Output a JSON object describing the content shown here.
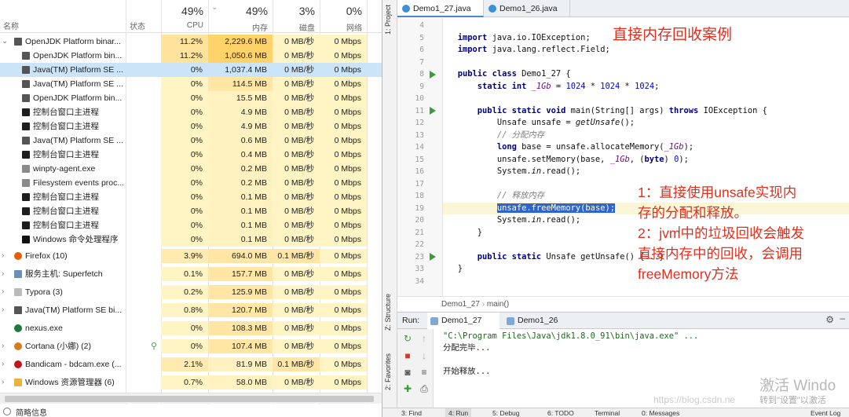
{
  "task_manager": {
    "columns": {
      "name": "名称",
      "status": "状态",
      "cpu": {
        "pct": "49%",
        "label": "CPU"
      },
      "memory": {
        "pct": "49%",
        "label": "内存"
      },
      "disk": {
        "pct": "3%",
        "label": "磁盘"
      },
      "network": {
        "pct": "0%",
        "label": "网络"
      }
    },
    "rows": [
      {
        "name": "OpenJDK Platform binar...",
        "cpu": "11.2%",
        "mem": "2,229.6 MB",
        "disk": "0 MB/秒",
        "net": "0 Mbps",
        "twisty": "open",
        "indent": 0,
        "icon": "java-icon",
        "color": "#555555"
      },
      {
        "name": "OpenJDK Platform bin...",
        "cpu": "11.2%",
        "mem": "1,050.6 MB",
        "disk": "0 MB/秒",
        "net": "0 Mbps",
        "twisty": "",
        "indent": 1,
        "icon": "java-icon",
        "color": "#555555"
      },
      {
        "name": "Java(TM) Platform SE ...",
        "cpu": "0%",
        "mem": "1,037.4 MB",
        "disk": "0 MB/秒",
        "net": "0 Mbps",
        "twisty": "",
        "indent": 1,
        "icon": "java-icon",
        "color": "#555555",
        "selected": true
      },
      {
        "name": "Java(TM) Platform SE ...",
        "cpu": "0%",
        "mem": "114.5 MB",
        "disk": "0 MB/秒",
        "net": "0 Mbps",
        "twisty": "",
        "indent": 1,
        "icon": "java-icon",
        "color": "#555555"
      },
      {
        "name": "OpenJDK Platform bin...",
        "cpu": "0%",
        "mem": "15.5 MB",
        "disk": "0 MB/秒",
        "net": "0 Mbps",
        "twisty": "",
        "indent": 1,
        "icon": "java-icon",
        "color": "#555555"
      },
      {
        "name": "控制台窗口主进程",
        "cpu": "0%",
        "mem": "4.9 MB",
        "disk": "0 MB/秒",
        "net": "0 Mbps",
        "twisty": "",
        "indent": 1,
        "icon": "console-icon",
        "color": "#1e1e1e"
      },
      {
        "name": "控制台窗口主进程",
        "cpu": "0%",
        "mem": "4.9 MB",
        "disk": "0 MB/秒",
        "net": "0 Mbps",
        "twisty": "",
        "indent": 1,
        "icon": "console-icon",
        "color": "#1e1e1e"
      },
      {
        "name": "Java(TM) Platform SE ...",
        "cpu": "0%",
        "mem": "0.6 MB",
        "disk": "0 MB/秒",
        "net": "0 Mbps",
        "twisty": "",
        "indent": 1,
        "icon": "java-icon",
        "color": "#555555"
      },
      {
        "name": "控制台窗口主进程",
        "cpu": "0%",
        "mem": "0.4 MB",
        "disk": "0 MB/秒",
        "net": "0 Mbps",
        "twisty": "",
        "indent": 1,
        "icon": "console-icon",
        "color": "#1e1e1e"
      },
      {
        "name": "winpty-agent.exe",
        "cpu": "0%",
        "mem": "0.2 MB",
        "disk": "0 MB/秒",
        "net": "0 Mbps",
        "twisty": "",
        "indent": 1,
        "icon": "app-icon",
        "color": "#8a8a8a"
      },
      {
        "name": "Filesystem events proc...",
        "cpu": "0%",
        "mem": "0.2 MB",
        "disk": "0 MB/秒",
        "net": "0 Mbps",
        "twisty": "",
        "indent": 1,
        "icon": "app-icon",
        "color": "#8a8a8a"
      },
      {
        "name": "控制台窗口主进程",
        "cpu": "0%",
        "mem": "0.1 MB",
        "disk": "0 MB/秒",
        "net": "0 Mbps",
        "twisty": "",
        "indent": 1,
        "icon": "console-icon",
        "color": "#1e1e1e"
      },
      {
        "name": "控制台窗口主进程",
        "cpu": "0%",
        "mem": "0.1 MB",
        "disk": "0 MB/秒",
        "net": "0 Mbps",
        "twisty": "",
        "indent": 1,
        "icon": "console-icon",
        "color": "#1e1e1e"
      },
      {
        "name": "控制台窗口主进程",
        "cpu": "0%",
        "mem": "0.1 MB",
        "disk": "0 MB/秒",
        "net": "0 Mbps",
        "twisty": "",
        "indent": 1,
        "icon": "console-icon",
        "color": "#1e1e1e"
      },
      {
        "name": "Windows 命令处理程序",
        "cpu": "0%",
        "mem": "0.1 MB",
        "disk": "0 MB/秒",
        "net": "0 Mbps",
        "twisty": "",
        "indent": 1,
        "icon": "cmd-icon",
        "color": "#111111"
      },
      {
        "name": "Firefox (10)",
        "cpu": "3.9%",
        "mem": "694.0 MB",
        "disk": "0.1 MB/秒",
        "net": "0 Mbps",
        "twisty": "closed",
        "indent": 0,
        "icon": "firefox-icon",
        "color": "#e66000",
        "gap": true
      },
      {
        "name": "服务主机: Superfetch",
        "cpu": "0.1%",
        "mem": "157.7 MB",
        "disk": "0 MB/秒",
        "net": "0 Mbps",
        "twisty": "closed",
        "indent": 0,
        "icon": "gear-icon",
        "color": "#6a8fb8",
        "gap": true
      },
      {
        "name": "Typora (3)",
        "cpu": "0.2%",
        "mem": "125.9 MB",
        "disk": "0 MB/秒",
        "net": "0 Mbps",
        "twisty": "closed",
        "indent": 0,
        "icon": "typora-icon",
        "color": "#bbbbbb",
        "gap": true
      },
      {
        "name": "Java(TM) Platform SE bi...",
        "cpu": "0.8%",
        "mem": "120.7 MB",
        "disk": "0 MB/秒",
        "net": "0 Mbps",
        "twisty": "closed",
        "indent": 0,
        "icon": "java-icon",
        "color": "#555555",
        "gap": true
      },
      {
        "name": "nexus.exe",
        "cpu": "0%",
        "mem": "108.3 MB",
        "disk": "0 MB/秒",
        "net": "0 Mbps",
        "twisty": "",
        "indent": 0,
        "icon": "nexus-icon",
        "color": "#1b7a3e",
        "gap": true
      },
      {
        "name": "Cortana (小娜) (2)",
        "cpu": "0%",
        "mem": "107.4 MB",
        "disk": "0 MB/秒",
        "net": "0 Mbps",
        "twisty": "closed",
        "indent": 0,
        "icon": "cortana-icon",
        "color": "#d77a1f",
        "gap": true,
        "leaf": true
      },
      {
        "name": "Bandicam - bdcam.exe (...",
        "cpu": "2.1%",
        "mem": "81.9 MB",
        "disk": "0.1 MB/秒",
        "net": "0 Mbps",
        "twisty": "closed",
        "indent": 0,
        "icon": "record-icon",
        "color": "#c0171c",
        "gap": true
      },
      {
        "name": "Windows 资源管理器 (6)",
        "cpu": "0.7%",
        "mem": "58.0 MB",
        "disk": "0 MB/秒",
        "net": "0 Mbps",
        "twisty": "closed",
        "indent": 0,
        "icon": "folder-icon",
        "color": "#e8b53a",
        "gap": true
      }
    ],
    "footer": "简略信息"
  },
  "ide": {
    "sidebar": {
      "project": "1: Project",
      "structure": "Z: Structure",
      "favorites": "2: Favorites"
    },
    "tabs": [
      {
        "label": "Demo1_27.java",
        "active": true
      },
      {
        "label": "Demo1_26.java",
        "active": false
      }
    ],
    "code_lines": [
      {
        "n": "4",
        "html": ""
      },
      {
        "n": "5",
        "html": "<span class=\"kw\">import</span> java.io.IOException;"
      },
      {
        "n": "6",
        "html": "<span class=\"kw\">import</span> java.lang.reflect.Field;"
      },
      {
        "n": "7",
        "html": ""
      },
      {
        "n": "8",
        "html": "<span class=\"kw\">public class</span> Demo1_27 {",
        "run": true
      },
      {
        "n": "9",
        "html": "    <span class=\"kw\">static int</span> <span class=\"it\">_1Gb</span> = <span class=\"num\">1024</span> * <span class=\"num\">1024</span> * <span class=\"num\">1024</span>;"
      },
      {
        "n": "10",
        "html": ""
      },
      {
        "n": "11",
        "html": "    <span class=\"kw\">public static void</span> main(String[] args) <span class=\"kw\">throws</span> IOException {",
        "run": true
      },
      {
        "n": "12",
        "html": "        Unsafe unsafe = <i>getUnsafe</i>();"
      },
      {
        "n": "13",
        "html": "        <span class=\"cm\">// 分配内存</span>"
      },
      {
        "n": "14",
        "html": "        <span class=\"kw\">long</span> base = unsafe.allocateMemory(<span class=\"it\">_1Gb</span>);"
      },
      {
        "n": "15",
        "html": "        unsafe.setMemory(base, <span class=\"it\">_1Gb</span>, (<span class=\"kw\">byte</span>) <span class=\"num\">0</span>);"
      },
      {
        "n": "16",
        "html": "        System.<i>in</i>.read();"
      },
      {
        "n": "17",
        "html": ""
      },
      {
        "n": "18",
        "html": "        <span class=\"cm\">// 释放内存</span>"
      },
      {
        "n": "19",
        "html": "        <span class=\"sel\">unsafe.freeMemory(base);</span>",
        "hl": true
      },
      {
        "n": "20",
        "html": "        System.<i>in</i>.read();"
      },
      {
        "n": "21",
        "html": "    }"
      },
      {
        "n": "22",
        "html": ""
      },
      {
        "n": "23",
        "html": "    <span class=\"kw\">public static</span> Unsafe getUnsafe() {...}",
        "run": true
      },
      {
        "n": "33",
        "html": "}"
      },
      {
        "n": "34",
        "html": ""
      }
    ],
    "annotation_title": "直接内存回收案例",
    "annotation_notes": [
      "1：直接使用unsafe实现内",
      "存的分配和释放。",
      "2：jvm中的垃圾回收会触发",
      "直接内存中的回收，会调用",
      "freeMemory方法"
    ],
    "breadcrumb": [
      "Demo1_27",
      "main()"
    ],
    "run": {
      "label": "Run:",
      "tabs": [
        "Demo1_27",
        "Demo1_26"
      ],
      "lines": [
        "\"C:\\Program Files\\Java\\jdk1.8.0_91\\bin\\java.exe\" ...",
        "分配完毕...",
        "",
        "开始释放..."
      ]
    },
    "watermark": {
      "line1": "激活 Windo",
      "line2": "转到\"设置\"以激活",
      "csdn": "https://blog.csdn.ne"
    },
    "statusbar": [
      "3: Find",
      "4: Run",
      "5: Debug",
      "6: TODO",
      "Terminal",
      "0: Messages",
      "Event Log"
    ]
  }
}
